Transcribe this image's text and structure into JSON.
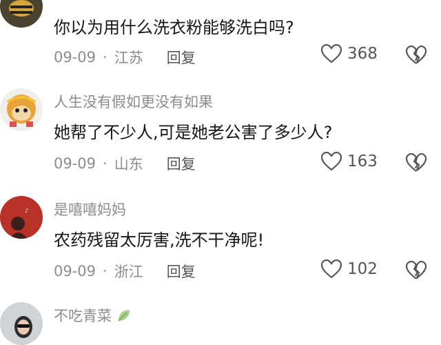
{
  "comments": [
    {
      "username": "",
      "text": "你以为用什么洗衣粉能够洗白吗?",
      "date": "09-09",
      "location": "江苏",
      "reply_label": "回复",
      "likes": "368",
      "avatar_icon": "bee-avatar"
    },
    {
      "username": "人生没有假如更没有如果",
      "text": "她帮了不少人,可是她老公害了多少人?",
      "date": "09-09",
      "location": "山东",
      "reply_label": "回复",
      "likes": "163",
      "avatar_icon": "monkey-king-avatar"
    },
    {
      "username": "是嘻嘻妈妈",
      "text": "农药残留太厉害,洗不干净呢!",
      "date": "09-09",
      "location": "浙江",
      "reply_label": "回复",
      "likes": "102",
      "avatar_icon": "girl-red-background-avatar"
    },
    {
      "username": "不吃青菜",
      "avatar_icon": "girl-sunglasses-avatar"
    }
  ],
  "colors": {
    "meta_gray": "#8c8c8c",
    "text": "#161616"
  }
}
